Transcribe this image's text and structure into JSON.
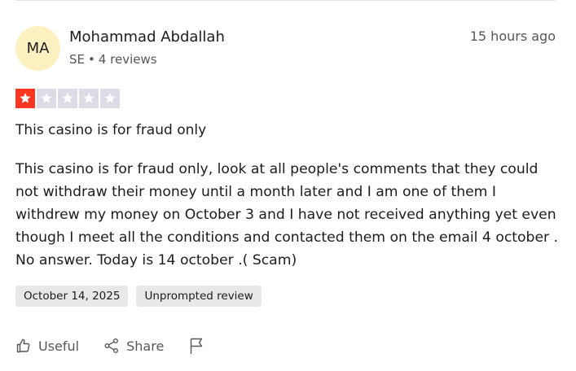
{
  "review": {
    "avatar_initials": "MA",
    "author_name": "Mohammad Abdallah",
    "author_country": "SE",
    "author_reviews": "4 reviews",
    "meta_separator": "•",
    "timestamp": "15 hours ago",
    "rating": 1,
    "rating_max": 5,
    "title": "This casino is for fraud only",
    "body": "This casino is for fraud only, look at all people's comments that they could not withdraw their money until a month later and I am one of them I withdrew my money on October 3 and I have not received anything yet even though I meet all the conditions and contacted them on the email 4 october . No answer. Today is 14 october .( Scam)",
    "date_badge": "October 14, 2025",
    "type_badge": "Unprompted review"
  },
  "actions": {
    "useful_label": "Useful",
    "share_label": "Share"
  },
  "icons": {
    "useful": "thumbs-up-icon",
    "share": "share-icon",
    "report": "flag-icon",
    "star": "star-icon"
  },
  "colors": {
    "star_filled": "#ff3722",
    "star_empty": "#dcdce6",
    "avatar_bg": "#fdf1c2",
    "badge_bg": "#e8e8e8",
    "text_primary": "#1c1c1c",
    "text_secondary": "#575757"
  }
}
